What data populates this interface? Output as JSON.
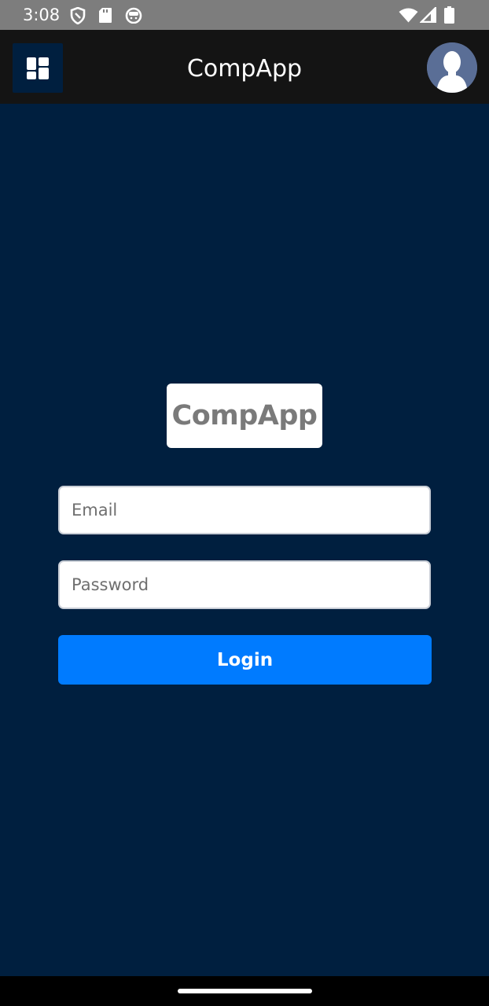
{
  "status_bar": {
    "time": "3:08",
    "icons": [
      "shield-icon",
      "sd-card-icon",
      "android-face-icon",
      "wifi-icon",
      "signal-icon",
      "battery-icon"
    ]
  },
  "app_bar": {
    "title": "CompApp",
    "menu_icon": "dashboard-grid-icon",
    "avatar_icon": "user-avatar-icon"
  },
  "login": {
    "logo_text": "CompApp",
    "email_placeholder": "Email",
    "email_value": "",
    "password_placeholder": "Password",
    "password_value": "",
    "login_label": "Login"
  },
  "colors": {
    "background": "#001f3f",
    "app_bar": "#141414",
    "status_bar": "#7d7d7d",
    "login_button": "#007bff",
    "logo_text": "#7a7a7a"
  }
}
